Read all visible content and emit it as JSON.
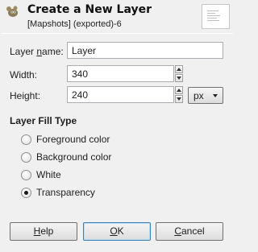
{
  "dialog": {
    "title": "Create a New Layer",
    "subtitle": "[Mapshots] (exported)-6",
    "icon": "gimp-wilber-icon",
    "preview_icon": "layer-preview-icon"
  },
  "form": {
    "layer_name": {
      "label_pre": "Layer ",
      "label_mnemonic": "n",
      "label_post": "ame:",
      "value": "Layer"
    },
    "width": {
      "label": "Width:",
      "value": "340"
    },
    "height": {
      "label": "Height:",
      "value": "240"
    },
    "unit": {
      "value": "px",
      "icon": "dropdown-arrow-icon"
    }
  },
  "fill_type": {
    "heading": "Layer Fill Type",
    "options": [
      {
        "label": "Foreground color",
        "checked": false
      },
      {
        "label": "Background color",
        "checked": false
      },
      {
        "label": "White",
        "checked": false
      },
      {
        "label": "Transparency",
        "checked": true
      }
    ]
  },
  "buttons": {
    "help": {
      "mnemonic": "H",
      "rest": "elp"
    },
    "ok": {
      "mnemonic": "O",
      "rest": "K"
    },
    "cancel": {
      "mnemonic": "C",
      "rest": "ancel"
    }
  },
  "colors": {
    "background": "#f0f0f0",
    "default_button_border": "#3c7fb1"
  }
}
